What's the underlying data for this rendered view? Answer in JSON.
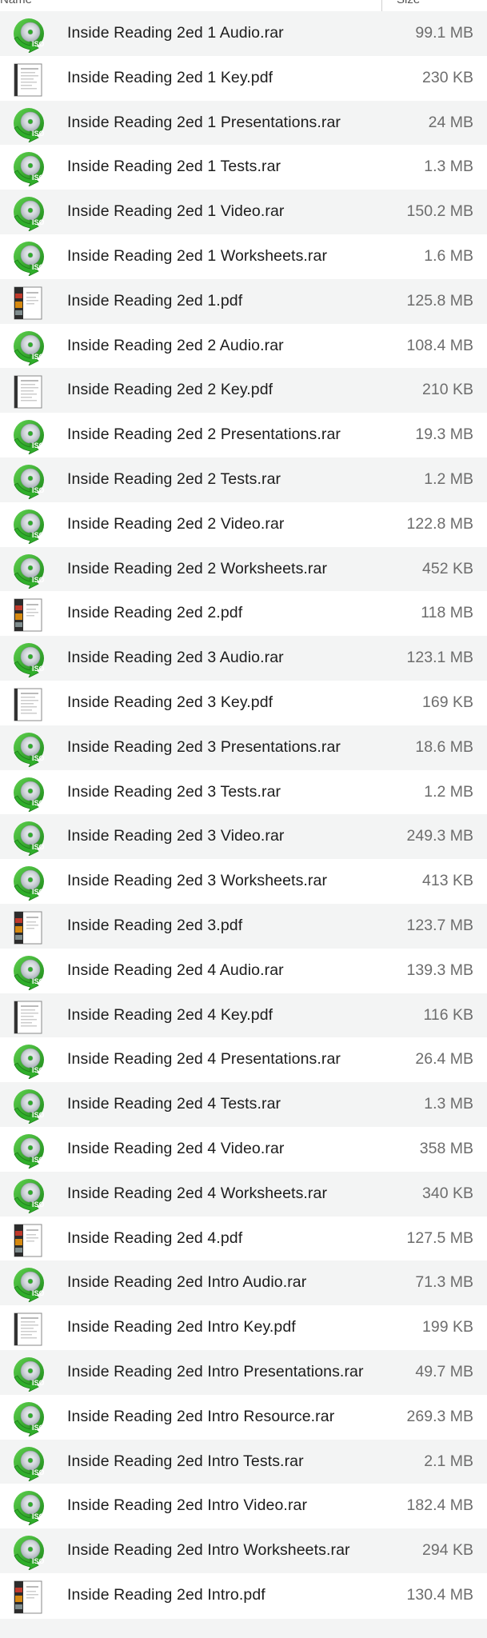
{
  "header": {
    "name_col": "Name",
    "size_col": "Size"
  },
  "colors": {
    "iso_green": "#2fae2a",
    "iso_dark": "#1f7f1c",
    "disc_silver": "#d9dde0",
    "alt_row": "#f3f4f4"
  },
  "files": [
    {
      "name": "Inside Reading 2ed 1 Audio.rar",
      "size": "99.1 MB",
      "icon": "iso-disc-icon"
    },
    {
      "name": "Inside Reading 2ed 1 Key.pdf",
      "size": "230 KB",
      "icon": "pdf-key-icon"
    },
    {
      "name": "Inside Reading 2ed 1 Presentations.rar",
      "size": "24 MB",
      "icon": "iso-disc-icon"
    },
    {
      "name": "Inside Reading 2ed 1 Tests.rar",
      "size": "1.3 MB",
      "icon": "iso-disc-icon"
    },
    {
      "name": "Inside Reading 2ed 1 Video.rar",
      "size": "150.2 MB",
      "icon": "iso-disc-icon"
    },
    {
      "name": "Inside Reading 2ed 1 Worksheets.rar",
      "size": "1.6 MB",
      "icon": "iso-disc-icon"
    },
    {
      "name": "Inside Reading 2ed 1.pdf",
      "size": "125.8 MB",
      "icon": "pdf-book-icon"
    },
    {
      "name": "Inside Reading 2ed 2 Audio.rar",
      "size": "108.4 MB",
      "icon": "iso-disc-icon"
    },
    {
      "name": "Inside Reading 2ed 2 Key.pdf",
      "size": "210 KB",
      "icon": "pdf-key-icon"
    },
    {
      "name": "Inside Reading 2ed 2 Presentations.rar",
      "size": "19.3 MB",
      "icon": "iso-disc-icon"
    },
    {
      "name": "Inside Reading 2ed 2 Tests.rar",
      "size": "1.2 MB",
      "icon": "iso-disc-icon"
    },
    {
      "name": "Inside Reading 2ed 2 Video.rar",
      "size": "122.8 MB",
      "icon": "iso-disc-icon"
    },
    {
      "name": "Inside Reading 2ed 2 Worksheets.rar",
      "size": "452 KB",
      "icon": "iso-disc-icon"
    },
    {
      "name": "Inside Reading 2ed 2.pdf",
      "size": "118 MB",
      "icon": "pdf-book-icon"
    },
    {
      "name": "Inside Reading 2ed 3 Audio.rar",
      "size": "123.1 MB",
      "icon": "iso-disc-icon"
    },
    {
      "name": "Inside Reading 2ed 3 Key.pdf",
      "size": "169 KB",
      "icon": "pdf-key-icon"
    },
    {
      "name": "Inside Reading 2ed 3 Presentations.rar",
      "size": "18.6 MB",
      "icon": "iso-disc-icon"
    },
    {
      "name": "Inside Reading 2ed 3 Tests.rar",
      "size": "1.2 MB",
      "icon": "iso-disc-icon"
    },
    {
      "name": "Inside Reading 2ed 3 Video.rar",
      "size": "249.3 MB",
      "icon": "iso-disc-icon"
    },
    {
      "name": "Inside Reading 2ed 3 Worksheets.rar",
      "size": "413 KB",
      "icon": "iso-disc-icon"
    },
    {
      "name": "Inside Reading 2ed 3.pdf",
      "size": "123.7 MB",
      "icon": "pdf-book-icon"
    },
    {
      "name": "Inside Reading 2ed 4 Audio.rar",
      "size": "139.3 MB",
      "icon": "iso-disc-icon"
    },
    {
      "name": "Inside Reading 2ed 4 Key.pdf",
      "size": "116 KB",
      "icon": "pdf-key-icon"
    },
    {
      "name": "Inside Reading 2ed 4 Presentations.rar",
      "size": "26.4 MB",
      "icon": "iso-disc-icon"
    },
    {
      "name": "Inside Reading 2ed 4 Tests.rar",
      "size": "1.3 MB",
      "icon": "iso-disc-icon"
    },
    {
      "name": "Inside Reading 2ed 4 Video.rar",
      "size": "358 MB",
      "icon": "iso-disc-icon"
    },
    {
      "name": "Inside Reading 2ed 4 Worksheets.rar",
      "size": "340 KB",
      "icon": "iso-disc-icon"
    },
    {
      "name": "Inside Reading 2ed 4.pdf",
      "size": "127.5 MB",
      "icon": "pdf-book-icon"
    },
    {
      "name": "Inside Reading 2ed Intro Audio.rar",
      "size": "71.3 MB",
      "icon": "iso-disc-icon"
    },
    {
      "name": "Inside Reading 2ed Intro Key.pdf",
      "size": "199 KB",
      "icon": "pdf-key-icon"
    },
    {
      "name": "Inside Reading 2ed Intro Presentations.rar",
      "size": "49.7 MB",
      "icon": "iso-disc-icon"
    },
    {
      "name": "Inside Reading 2ed Intro Resource.rar",
      "size": "269.3 MB",
      "icon": "iso-disc-icon"
    },
    {
      "name": "Inside Reading 2ed Intro Tests.rar",
      "size": "2.1 MB",
      "icon": "iso-disc-icon"
    },
    {
      "name": "Inside Reading 2ed Intro Video.rar",
      "size": "182.4 MB",
      "icon": "iso-disc-icon"
    },
    {
      "name": "Inside Reading 2ed Intro Worksheets.rar",
      "size": "294 KB",
      "icon": "iso-disc-icon"
    },
    {
      "name": "Inside Reading 2ed Intro.pdf",
      "size": "130.4 MB",
      "icon": "pdf-book-icon"
    }
  ]
}
